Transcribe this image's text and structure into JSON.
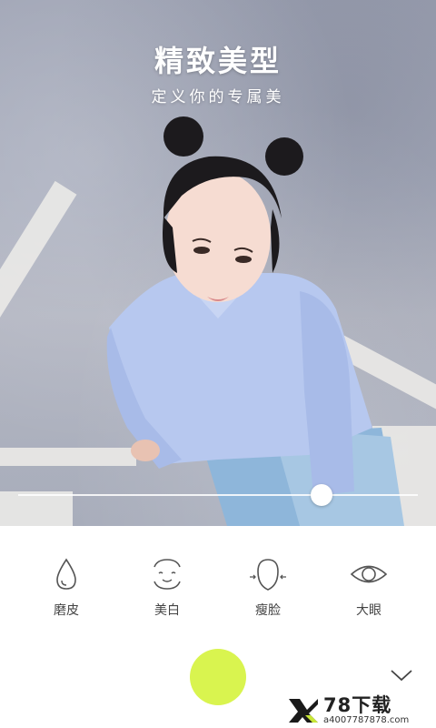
{
  "header": {
    "title": "精致美型",
    "subtitle": "定义你的专属美"
  },
  "slider": {
    "value": 0.76
  },
  "tools": [
    {
      "label": "磨皮",
      "icon": "water-drop-icon"
    },
    {
      "label": "美白",
      "icon": "face-whiten-icon"
    },
    {
      "label": "瘦脸",
      "icon": "face-slim-icon"
    },
    {
      "label": "大眼",
      "icon": "eye-icon"
    }
  ],
  "shutter": {
    "color": "#d9f44f"
  },
  "collapse": {
    "icon": "chevron-down-icon"
  },
  "watermark": {
    "logo": "78-logo",
    "title": "78下载",
    "url": "a4007787878.com"
  }
}
